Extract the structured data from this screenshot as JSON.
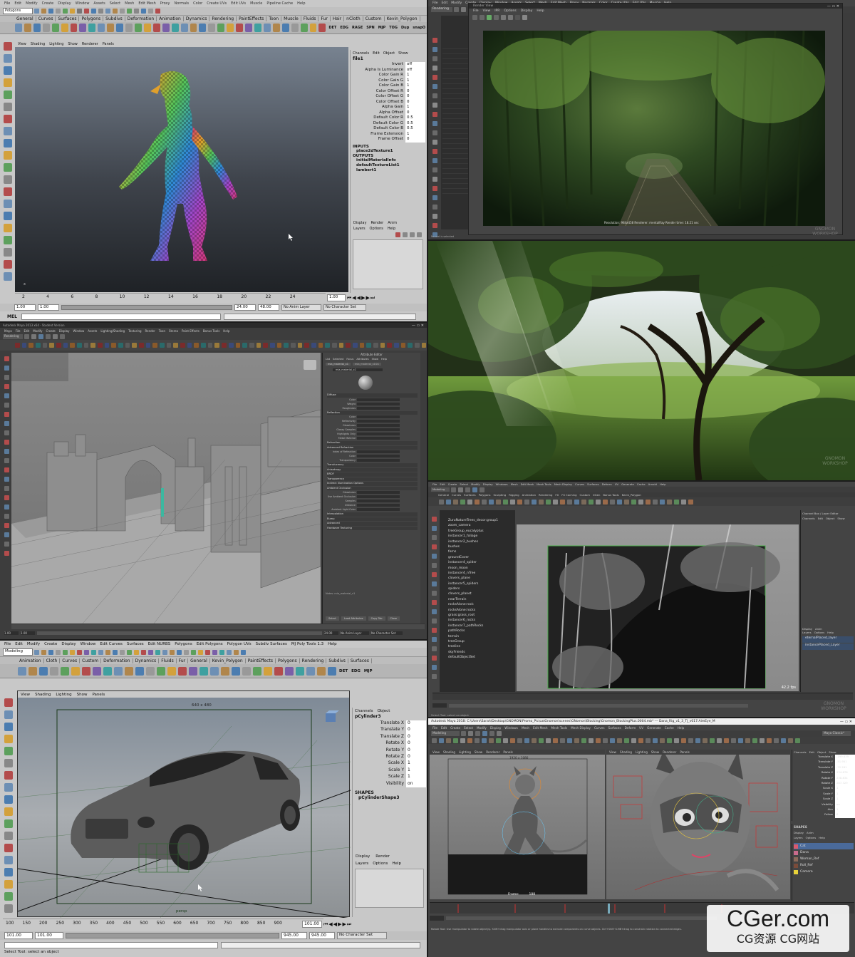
{
  "panel1": {
    "menu": [
      "File",
      "Edit",
      "Modify",
      "Create",
      "Display",
      "Window",
      "Assets",
      "Select",
      "Mesh",
      "Edit Mesh",
      "Proxy",
      "Normals",
      "Color",
      "Create UVs",
      "Edit UVs",
      "Muscle",
      "Pipeline Cache",
      "Help"
    ],
    "mode": "Polygons",
    "shelf_tabs": [
      "General",
      "Curves",
      "Surfaces",
      "Polygons",
      "Subdivs",
      "Deformation",
      "Animation",
      "Dynamics",
      "Rendering",
      "PaintEffects",
      "Toon",
      "Muscle",
      "Fluids",
      "Fur",
      "Hair",
      "nCloth",
      "Custom",
      "Kevin_Polygon"
    ],
    "shelf_labels": [
      "DET",
      "EDG",
      "RAGE",
      "SPN",
      "MJP",
      "TOG",
      "Dup",
      "snapO"
    ],
    "viewport_menu": [
      "View",
      "Shading",
      "Lighting",
      "Show",
      "Renderer",
      "Panels"
    ],
    "channel_tabs": [
      "Channels",
      "Edit",
      "Object",
      "Show"
    ],
    "node_name": "file1",
    "attrs": [
      {
        "n": "Invert",
        "v": "off"
      },
      {
        "n": "Alpha Is Luminance",
        "v": "off"
      },
      {
        "n": "Color Gain R",
        "v": "1"
      },
      {
        "n": "Color Gain G",
        "v": "1"
      },
      {
        "n": "Color Gain B",
        "v": "1"
      },
      {
        "n": "Color Offset R",
        "v": "0"
      },
      {
        "n": "Color Offset G",
        "v": "0"
      },
      {
        "n": "Color Offset B",
        "v": "0"
      },
      {
        "n": "Alpha Gain",
        "v": "1"
      },
      {
        "n": "Alpha Offset",
        "v": "0"
      },
      {
        "n": "Default Color R",
        "v": "0.5"
      },
      {
        "n": "Default Color G",
        "v": "0.5"
      },
      {
        "n": "Default Color B",
        "v": "0.5"
      },
      {
        "n": "Frame Extension",
        "v": "1"
      },
      {
        "n": "Frame Offset",
        "v": "0"
      }
    ],
    "inputs_header": "INPUTS",
    "inputs": [
      "place2dTexture1"
    ],
    "outputs_header": "OUTPUTS",
    "outputs": [
      "initialMaterialInfo",
      "defaultTextureList1",
      "lambert1"
    ],
    "layer_tabs": [
      "Display",
      "Render",
      "Anim"
    ],
    "layer_menu": [
      "Layers",
      "Options",
      "Help"
    ],
    "ticks": [
      "2",
      "4",
      "6",
      "8",
      "10",
      "12",
      "14",
      "16",
      "18",
      "20",
      "22",
      "24"
    ],
    "current_frame": "1.00",
    "range_start": "1.00",
    "range_start2": "1.00",
    "range_end": "24.00",
    "range_end2": "48.00",
    "anim_layer": "No Anim Layer",
    "char_set": "No Character Set",
    "mel": "MEL"
  },
  "panel2": {
    "menu": [
      "File",
      "Edit",
      "Modify",
      "Create",
      "Display",
      "Window",
      "Assets",
      "Select",
      "Mesh",
      "Edit Mesh",
      "Proxy",
      "Normals",
      "Color",
      "Create UVs",
      "Edit UVs",
      "Muscle",
      "Help"
    ],
    "mode": "Rendering",
    "render_title": "Render View",
    "render_menu": [
      "File",
      "View",
      "IPR",
      "Options",
      "Display",
      "Help"
    ],
    "status": "Resolution: 984x458   Renderer: mentalRay   Render time: 18.21 sec",
    "side_text": "No mel is selected",
    "watermark": "GNOMON WORKSHOP"
  },
  "panel3": {
    "watermark": "GNOMON WORKSHOP"
  },
  "panel4": {
    "title": "Autodesk Maya 2013 x64 - Student Version",
    "menu": [
      "Maya",
      "File",
      "Edit",
      "Modify",
      "Create",
      "Display",
      "Window",
      "Assets",
      "Lighting/Shading",
      "Texturing",
      "Render",
      "Toon",
      "Stereo",
      "Paint Effects",
      "Bonus Tools",
      "Help"
    ],
    "mode": "Rendering",
    "editor_title": "Attribute Editor",
    "editor_menu": [
      "List",
      "Selected",
      "Focus",
      "Attributes",
      "Show",
      "Help"
    ],
    "material_name": "mia_material_x1",
    "shader_tab": "mia_material_x1",
    "section_labels": [
      "Diffuse",
      "Reflection",
      "Refraction",
      "Advanced Refraction",
      "Translucency",
      "Anisotropy",
      "BRDF",
      "Transparency",
      "Indirect Illumination Options",
      "Ambient Occlusion",
      "Interpolation",
      "Bump",
      "Advanced",
      "Hardware Texturing"
    ],
    "attr_labels": [
      "Color",
      "Weight",
      "Roughness",
      "Color",
      "Reflectivity",
      "Glossiness",
      "Glossy Samples",
      "Highlights Only",
      "Metal Material",
      "Index of Refraction",
      "Color",
      "Transparency",
      "Glossiness",
      "Use Ambient Occlusion",
      "Samples",
      "Distance",
      "Ambient Light Color",
      "Use Detail Distance"
    ],
    "buttons": [
      "Select",
      "Load Attributes",
      "Copy Tab",
      "Close"
    ],
    "footer": "Notes: mia_material_x1",
    "range_start": "1.00",
    "range_end": "24.00",
    "anim_layer": "No Anim Layer",
    "char_set": "No Character Set"
  },
  "panel5": {
    "title": "Autodesk Maya 2016 - Student Version",
    "menu": [
      "File",
      "Edit",
      "Create",
      "Select",
      "Modify",
      "Display",
      "Windows",
      "Mesh",
      "Edit Mesh",
      "Mesh Tools",
      "Mesh Display",
      "Curves",
      "Surfaces",
      "Deform",
      "UV",
      "Generate",
      "Cache",
      "Arnold",
      "Help"
    ],
    "mode": "Modeling",
    "shelf_tabs": [
      "General",
      "Curves",
      "Surfaces",
      "Polygons",
      "Sculpting",
      "Rigging",
      "Animation",
      "Rendering",
      "FX",
      "FX Caching",
      "Custom",
      "XGen",
      "Bonus Tools",
      "Kevin_Polygon"
    ],
    "outliner": [
      "ZuruNatureTrees_decor:group1",
      "zoom_camera",
      "treeGroup_eucalyptus",
      "instancer1_foliage",
      "instancer2_bushes",
      "bushes",
      "ferns",
      "groundCover",
      "instancer4_spider",
      "moon_moon",
      "instancer4_nTree",
      "clovers_plane",
      "instancer5_spiders",
      "spiders",
      "clovers_planet",
      "nearTerrain",
      "rocksAlone:rock",
      "rocksAlone:rocks",
      "grass:grass_root",
      "instancer6_rocks",
      "instancer7_pathRocks",
      "pathRocks",
      "terrain",
      "treeGroup",
      "treeline",
      "skyFriends",
      "defaultObjectSet"
    ],
    "channel_tabs": [
      "Channel Box / Layer Editor"
    ],
    "channel_menu": [
      "Channels",
      "Edit",
      "Object",
      "Show"
    ],
    "layer_tabs": [
      "Display",
      "Anim"
    ],
    "layer_menu": [
      "Layers",
      "Options",
      "Help"
    ],
    "layers": [
      "eternalPlaced_layer",
      "instancePlaced_Layer"
    ],
    "fps": "42.2 fps",
    "status": "Select Tool: select an object",
    "watermark": "GNOMON WORKSHOP"
  },
  "panel6": {
    "menu": [
      "File",
      "Edit",
      "Modify",
      "Create",
      "Display",
      "Window",
      "Edit Curves",
      "Surfaces",
      "Edit NURBS",
      "Polygons",
      "Edit Polygons",
      "Polygon UVs",
      "Subdiv Surfaces",
      "MJ Poly Tools 1.3",
      "Help"
    ],
    "mode": "Modeling",
    "shelf_tabs": [
      "Animation",
      "Cloth",
      "Curves",
      "Custom",
      "Deformation",
      "Dynamics",
      "Fluids",
      "Fur",
      "General",
      "Kevin_Polygon",
      "PaintEffects",
      "Polygons",
      "Rendering",
      "Subdivs",
      "Surfaces"
    ],
    "shelf_labels": [
      "DET",
      "EDG",
      "MJP"
    ],
    "viewport_menu": [
      "View",
      "Shading",
      "Lighting",
      "Show",
      "Panels"
    ],
    "resolution": "640 x 480",
    "camera": "persp",
    "channel_menu": [
      "Channels",
      "Object"
    ],
    "object": "pCylinder3",
    "attrs": [
      {
        "n": "Translate X",
        "v": "0"
      },
      {
        "n": "Translate Y",
        "v": "0"
      },
      {
        "n": "Translate Z",
        "v": "0"
      },
      {
        "n": "Rotate X",
        "v": "0"
      },
      {
        "n": "Rotate Y",
        "v": "0"
      },
      {
        "n": "Rotate Z",
        "v": "0"
      },
      {
        "n": "Scale X",
        "v": "1"
      },
      {
        "n": "Scale Y",
        "v": "1"
      },
      {
        "n": "Scale Z",
        "v": "1"
      },
      {
        "n": "Visibility",
        "v": "on"
      }
    ],
    "shapes_header": "SHAPES",
    "shape": "pCylinderShape3",
    "layer_tabs": [
      "Display",
      "Render"
    ],
    "layer_menu": [
      "Layers",
      "Options",
      "Help"
    ],
    "ticks": [
      "100",
      "150",
      "200",
      "250",
      "300",
      "350",
      "400",
      "450",
      "500",
      "550",
      "600",
      "650",
      "700",
      "750",
      "800",
      "850",
      "900"
    ],
    "current_frame": "101.00",
    "range_start": "101.00",
    "range_start2": "101.00",
    "range_end": "945.00",
    "range_end2": "945.00",
    "char_set": "No Character Set",
    "status": "Select Tool: select an object"
  },
  "panel7": {
    "title": "Autodesk Maya 2018: C:\\Users\\Sarah\\Desktop\\GNOMON\\Promo_Pic\\catGnomon\\scenes\\GNomon\\Blocking\\Gnomon_BlockingPlus.0004.mb*  ---  Dana_Rig_v1_3_TJ_v017:AimEye_M",
    "menu": [
      "File",
      "Edit",
      "Create",
      "Select",
      "Modify",
      "Display",
      "Windows",
      "Mesh",
      "Edit Mesh",
      "Mesh Tools",
      "Mesh Display",
      "Curves",
      "Surfaces",
      "Deform",
      "UV",
      "Generate",
      "Cache",
      "Help"
    ],
    "mode": "Modeling",
    "workspace": "Maya Classic*",
    "viewport_menu": [
      "View",
      "Shading",
      "Lighting",
      "Show",
      "Renderer",
      "Panels"
    ],
    "resolution": "1920 x 1080",
    "frame_label": "Frame:",
    "frame_value": "188",
    "channel_menu": [
      "Channels",
      "Edit",
      "Object",
      "Show"
    ],
    "channel_attrs": [
      {
        "n": "Translate X",
        "v": "-199.639"
      },
      {
        "n": "Translate Y",
        "v": "-51.951"
      },
      {
        "n": "Translate Z",
        "v": "-72.291"
      },
      {
        "n": "Rotate X",
        "v": "234.876"
      },
      {
        "n": "Rotate Y",
        "v": "238.834"
      },
      {
        "n": "Rotate Z",
        "v": "287.329"
      },
      {
        "n": "Scale X",
        "v": "1"
      },
      {
        "n": "Scale Y",
        "v": "1"
      },
      {
        "n": "Scale Z",
        "v": "1"
      },
      {
        "n": "Visibility",
        "v": "on"
      },
      {
        "n": "Aim",
        "v": "1"
      },
      {
        "n": "Follow",
        "v": "0"
      }
    ],
    "shapes_header": "SHAPES",
    "layer_tabs": [
      "Display",
      "Anim"
    ],
    "layer_menu": [
      "Layers",
      "Options",
      "Help"
    ],
    "layers": [
      {
        "name": "Cat",
        "color": "#d95a6e"
      },
      {
        "name": "Dana",
        "color": "#c86b8c"
      },
      {
        "name": "Woman_Ref",
        "color": "#8b6a5a"
      },
      {
        "name": "Roll_Ref",
        "color": "#7a4b3a"
      },
      {
        "name": "Camera",
        "color": "#e8d23a"
      }
    ],
    "status": "Rotate Tool: Use manipulator to rotate object(s). Shift+drag manipulator axis or plane handles to extrude components on curve objects. Ctrl+Shift+LMB+drag to constrain rotation to connected edges."
  },
  "brand": {
    "logo_text": "CGer.com",
    "tagline": "CG资源  CG网站"
  }
}
